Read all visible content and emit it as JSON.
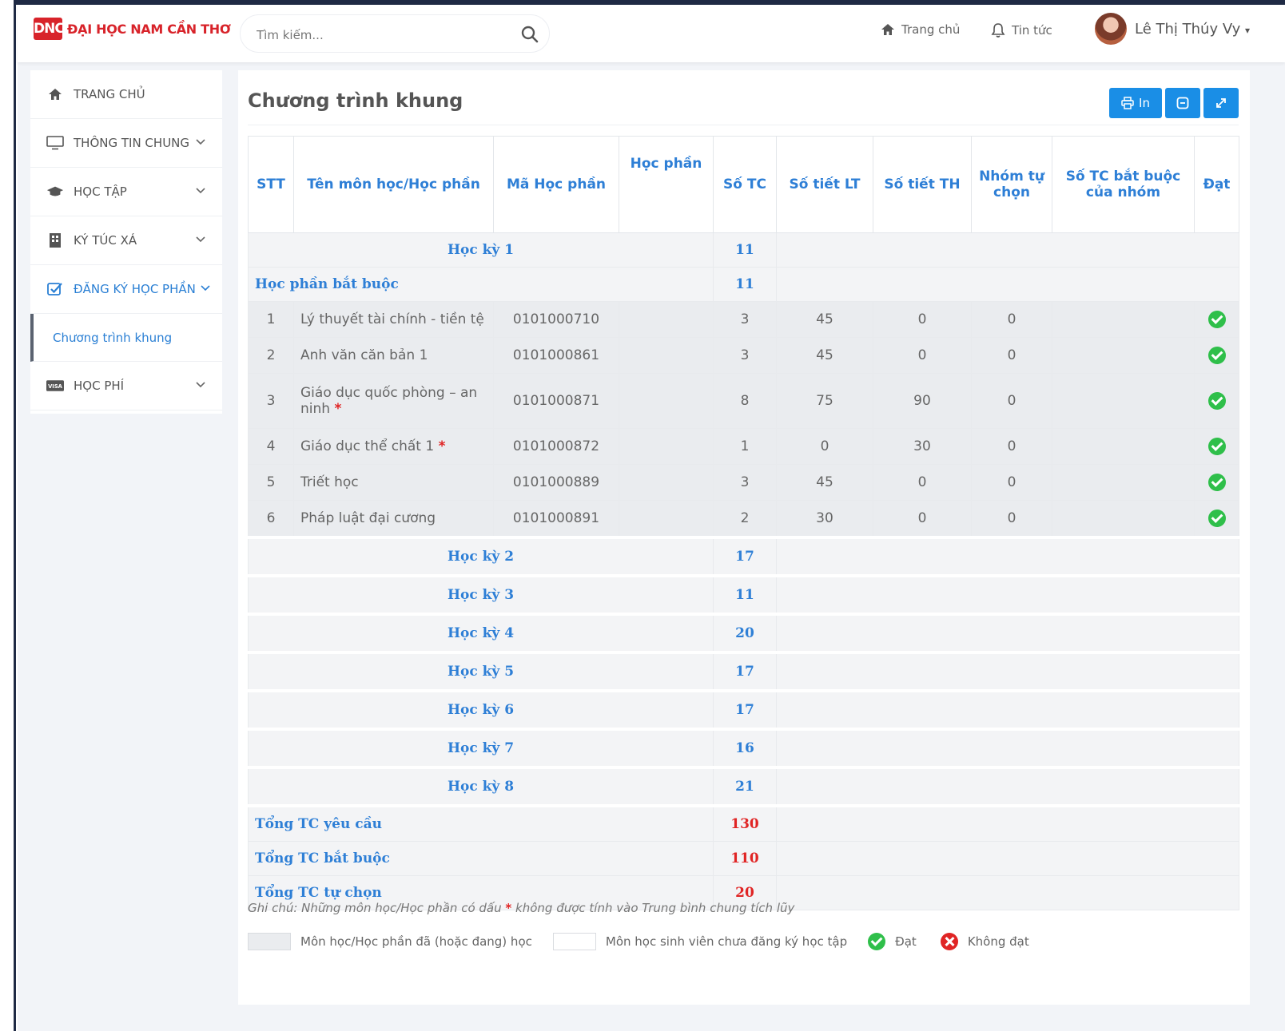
{
  "brand": {
    "logo_mark": "DNC",
    "name": "ĐẠI HỌC NAM CẦN THƠ",
    "color": "#d8232a"
  },
  "search": {
    "placeholder": "Tìm kiếm..."
  },
  "topnav": {
    "home": "Trang chủ",
    "news": "Tin tức",
    "user": "Lê Thị Thúy Vy"
  },
  "sidebar": {
    "items": [
      {
        "label": "TRANG CHỦ",
        "icon": "home-icon"
      },
      {
        "label": "THÔNG TIN CHUNG",
        "icon": "monitor-icon"
      },
      {
        "label": "HỌC TẬP",
        "icon": "graduation-cap-icon"
      },
      {
        "label": "KÝ TÚC XÁ",
        "icon": "building-icon"
      },
      {
        "label": "ĐĂNG KÝ HỌC PHẦN",
        "icon": "checkbox-icon"
      },
      {
        "label": "HỌC PHÍ",
        "icon": "visa-card-icon"
      }
    ],
    "sub_active": "Chương trình khung"
  },
  "page": {
    "title": "Chương trình khung",
    "print_label": "In"
  },
  "table": {
    "headers": [
      "STT",
      "Tên môn học/Học phần",
      "Mã Học phần",
      "Học phần",
      "Số TC",
      "Số tiết LT",
      "Số tiết TH",
      "Nhóm tự chọn",
      "Số TC bắt buộc của nhóm",
      "Đạt"
    ],
    "semester1": {
      "label": "Học kỳ 1",
      "tc": "11"
    },
    "required_group": {
      "label": "Học phần bắt buộc",
      "tc": "11"
    },
    "courses": [
      {
        "stt": "1",
        "name": "Lý thuyết tài chính - tiền tệ",
        "code": "0101000710",
        "tc": "3",
        "lt": "45",
        "th": "0",
        "group": "0",
        "star": ""
      },
      {
        "stt": "2",
        "name": "Anh văn căn bản 1",
        "code": "0101000861",
        "tc": "3",
        "lt": "45",
        "th": "0",
        "group": "0",
        "star": ""
      },
      {
        "stt": "3",
        "name": "Giáo dục quốc phòng – an ninh",
        "code": "0101000871",
        "tc": "8",
        "lt": "75",
        "th": "90",
        "group": "0",
        "star": "*"
      },
      {
        "stt": "4",
        "name": "Giáo dục thể chất 1",
        "code": "0101000872",
        "tc": "1",
        "lt": "0",
        "th": "30",
        "group": "0",
        "star": "*"
      },
      {
        "stt": "5",
        "name": "Triết học",
        "code": "0101000889",
        "tc": "3",
        "lt": "45",
        "th": "0",
        "group": "0",
        "star": ""
      },
      {
        "stt": "6",
        "name": "Pháp luật đại cương",
        "code": "0101000891",
        "tc": "2",
        "lt": "30",
        "th": "0",
        "group": "0",
        "star": ""
      }
    ],
    "semesters": [
      {
        "label": "Học kỳ 2",
        "tc": "17"
      },
      {
        "label": "Học kỳ 3",
        "tc": "11"
      },
      {
        "label": "Học kỳ 4",
        "tc": "20"
      },
      {
        "label": "Học kỳ 5",
        "tc": "17"
      },
      {
        "label": "Học kỳ 6",
        "tc": "17"
      },
      {
        "label": "Học kỳ 7",
        "tc": "16"
      },
      {
        "label": "Học kỳ 8",
        "tc": "21"
      }
    ],
    "totals": [
      {
        "label": "Tổng TC yêu cầu",
        "value": "130"
      },
      {
        "label": "Tổng TC bắt buộc",
        "value": "110"
      },
      {
        "label": "Tổng TC tự chọn",
        "value": "20"
      }
    ]
  },
  "note": {
    "prefix": "Ghi chú: Những môn học/Học phần có dấu",
    "star": "*",
    "suffix": "không được tính vào Trung bình chung tích lũy"
  },
  "legend": {
    "studied": "Môn học/Học phần đã (hoặc đang) học",
    "not_registered": "Môn học sinh viên chưa đăng ký học tập",
    "passed": "Đạt",
    "failed": "Không đạt"
  }
}
